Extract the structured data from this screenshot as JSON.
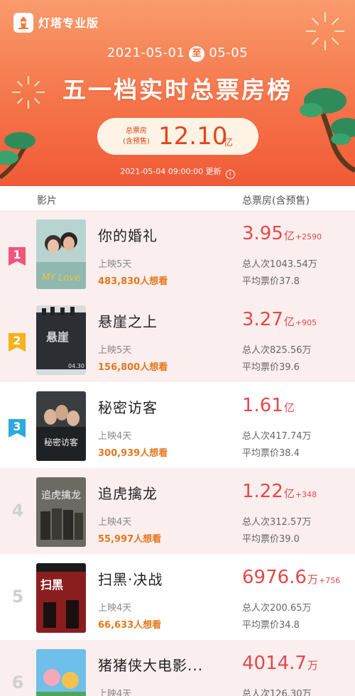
{
  "app": {
    "name": "灯塔专业版"
  },
  "header": {
    "date_start": "2021-05-01",
    "date_to": "至",
    "date_end": "05-05",
    "title": "五一档实时总票房榜",
    "total_label_line1": "总票房",
    "total_label_line2": "(含预售)",
    "total_value": "12.10",
    "total_unit": "亿",
    "update_time": "2021-05-04 09:00:00 更新"
  },
  "table": {
    "col_film": "影片",
    "col_box": "总票房(含预售)"
  },
  "movies": [
    {
      "rank": "1",
      "title": "你的婚礼",
      "days": "上映5天",
      "want": "483,830人想看",
      "box": "3.95",
      "unit": "亿",
      "delta": "+2590",
      "viewers": "总人次1043.54万",
      "avg": "平均票价37.8"
    },
    {
      "rank": "2",
      "title": "悬崖之上",
      "days": "上映5天",
      "want": "156,800人想看",
      "box": "3.27",
      "unit": "亿",
      "delta": "+905",
      "viewers": "总人次825.56万",
      "avg": "平均票价39.6"
    },
    {
      "rank": "3",
      "title": "秘密访客",
      "days": "上映4天",
      "want": "300,939人想看",
      "box": "1.61",
      "unit": "亿",
      "delta": "",
      "viewers": "总人次417.74万",
      "avg": "平均票价38.4"
    },
    {
      "rank": "4",
      "title": "追虎擒龙",
      "days": "上映4天",
      "want": "55,997人想看",
      "box": "1.22",
      "unit": "亿",
      "delta": "+348",
      "viewers": "总人次312.57万",
      "avg": "平均票价39.0"
    },
    {
      "rank": "5",
      "title": "扫黑·决战",
      "days": "上映4天",
      "want": "66,633人想看",
      "box": "6976.6",
      "unit": "万",
      "delta": "+756",
      "viewers": "总人次200.65万",
      "avg": "平均票价34.8"
    },
    {
      "rank": "6",
      "title": "猪猪侠大电影...",
      "days": "上映4天",
      "want": "",
      "box": "4014.7",
      "unit": "万",
      "delta": "",
      "viewers": "总人次126.30万",
      "avg": ""
    }
  ],
  "colors": {
    "rank1": "#f0567a",
    "rank2": "#f5b21a",
    "rank3": "#2ea8e0",
    "box_red": "#e54849",
    "want_orange": "#e4771e",
    "header_orange": "#f5744a"
  }
}
